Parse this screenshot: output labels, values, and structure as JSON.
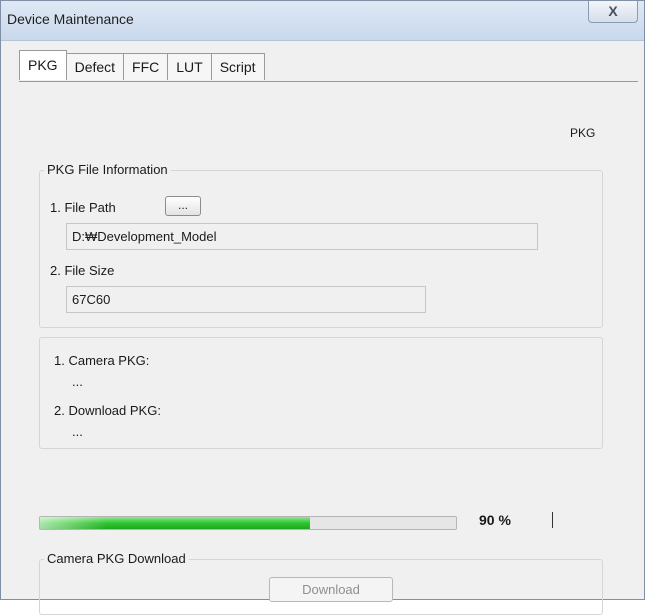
{
  "window": {
    "title": "Device Maintenance",
    "close_label": "X"
  },
  "tabs": [
    {
      "label": "PKG",
      "active": true
    },
    {
      "label": "Defect",
      "active": false
    },
    {
      "label": "FFC",
      "active": false
    },
    {
      "label": "LUT",
      "active": false
    },
    {
      "label": "Script",
      "active": false
    }
  ],
  "panel": {
    "header_label": "PKG",
    "file_info": {
      "group_title": "PKG File Information",
      "file_path_label": "1. File Path",
      "browse_button_label": "...",
      "file_path_value": "D:₩Development_Model",
      "file_size_label": "2. File Size",
      "file_size_value": "67C60"
    },
    "pkg_info": {
      "camera_pkg_label": "1. Camera PKG:",
      "camera_pkg_value": "...",
      "download_pkg_label": "2. Download PKG:",
      "download_pkg_value": "..."
    },
    "progress": {
      "value": 0.9,
      "percent_text": "90 %"
    },
    "download_group": {
      "group_title": "Camera PKG Download",
      "download_button_label": "Download"
    }
  },
  "colors": {
    "progress_fill": "#2fc52f",
    "titlebar": "#c9d8ec",
    "window_bg": "#f0f0f0"
  }
}
